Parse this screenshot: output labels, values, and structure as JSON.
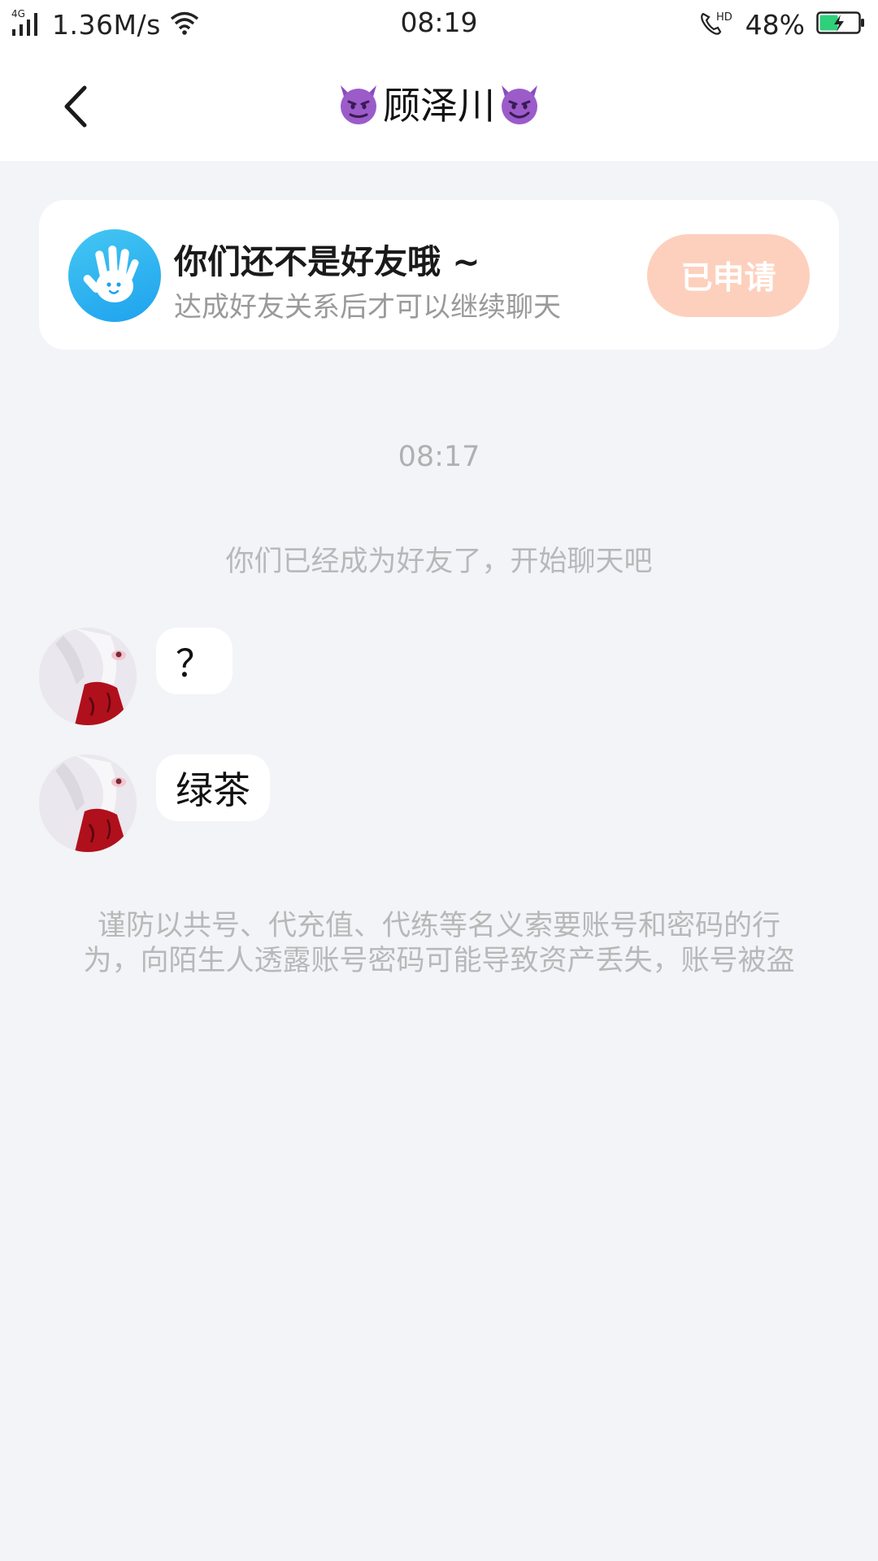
{
  "status_bar": {
    "network_type": "4G",
    "net_speed": "1.36M/s",
    "time": "08:19",
    "call_hd": "HD",
    "battery_percent": "48%",
    "battery_level": 0.48,
    "battery_color": "#2fd07a"
  },
  "nav": {
    "title": "顾泽川",
    "title_icon": "smiling-devil-emoji",
    "back_icon": "chevron-left-icon"
  },
  "friend_banner": {
    "icon": "waving-hand-icon",
    "title": "你们还不是好友哦 ~",
    "subtitle": "达成好友关系后才可以继续聊天",
    "button_label": "已申请",
    "button_color": "#fdd0bd"
  },
  "chat": {
    "timestamp": "08:17",
    "system_notice": "你们已经成为好友了，开始聊天吧",
    "messages": [
      {
        "sender": "other",
        "text": "？"
      },
      {
        "sender": "other",
        "text": "绿茶"
      }
    ],
    "warning_line1": "谨防以共号、代充值、代练等名义索要账号和密码的行",
    "warning_line2": "为，向陌生人透露账号密码可能导致资产丢失，账号被盗"
  }
}
